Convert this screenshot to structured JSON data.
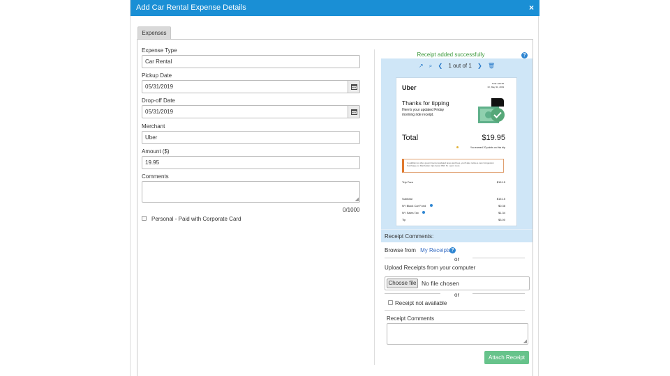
{
  "dialog": {
    "title": "Add Car Rental Expense Details",
    "close_label": "×"
  },
  "tabs": [
    {
      "label": "Expenses"
    }
  ],
  "form": {
    "expense_type": {
      "label": "Expense Type",
      "value": "Car Rental"
    },
    "pickup_date": {
      "label": "Pickup Date",
      "value": "05/31/2019"
    },
    "dropoff_date": {
      "label": "Drop-off Date",
      "value": "05/31/2019"
    },
    "merchant": {
      "label": "Merchant",
      "value": "Uber"
    },
    "amount": {
      "label": "Amount ($)",
      "value": "19.95"
    },
    "comments": {
      "label": "Comments",
      "value": "",
      "counter": "0/1000"
    },
    "personal": {
      "label": "Personal - Paid with Corporate Card",
      "checked": false
    }
  },
  "receipt_panel": {
    "success_message": "Receipt added successfully",
    "page_counter": "1 out of 1",
    "comments_title": "Receipt Comments:",
    "browse_from": "Browse from",
    "my_receipts": "My Receipts",
    "or1": "or",
    "upload_label": "Upload Receipts from your computer",
    "choose_file": "Choose file",
    "no_file": "No file chosen",
    "or2": "or",
    "not_available": "Receipt not available",
    "receipt_comments_label": "Receipt Comments",
    "attach_button": "Attach Receipt"
  },
  "receipt_image": {
    "brand": "Uber",
    "date_line1": "Total: $19.95",
    "date_line2": "Fri, May 31, 2019",
    "heading": "Thanks for tipping",
    "subtext1": "Here's your updated Friday",
    "subtext2": "morning ride receipt.",
    "total_label": "Total",
    "total_value": "$19.95",
    "points": "You earned 20 points on this trip",
    "notice": "In addition to other government-mandated taxes and fees, you'll also notice a new Congestion Surcharge on Manhattan trips below 96th St. Learn more",
    "rows": [
      {
        "label": "Trip Fare",
        "value": "$15.15"
      },
      {
        "label": "Subtotal",
        "value": "$15.15"
      },
      {
        "label": "NY Black Car Fund",
        "value": "$0.38"
      },
      {
        "label": "NY Sales Tax",
        "value": "$1.34"
      },
      {
        "label": "Tip",
        "value": "$3.00"
      }
    ]
  }
}
